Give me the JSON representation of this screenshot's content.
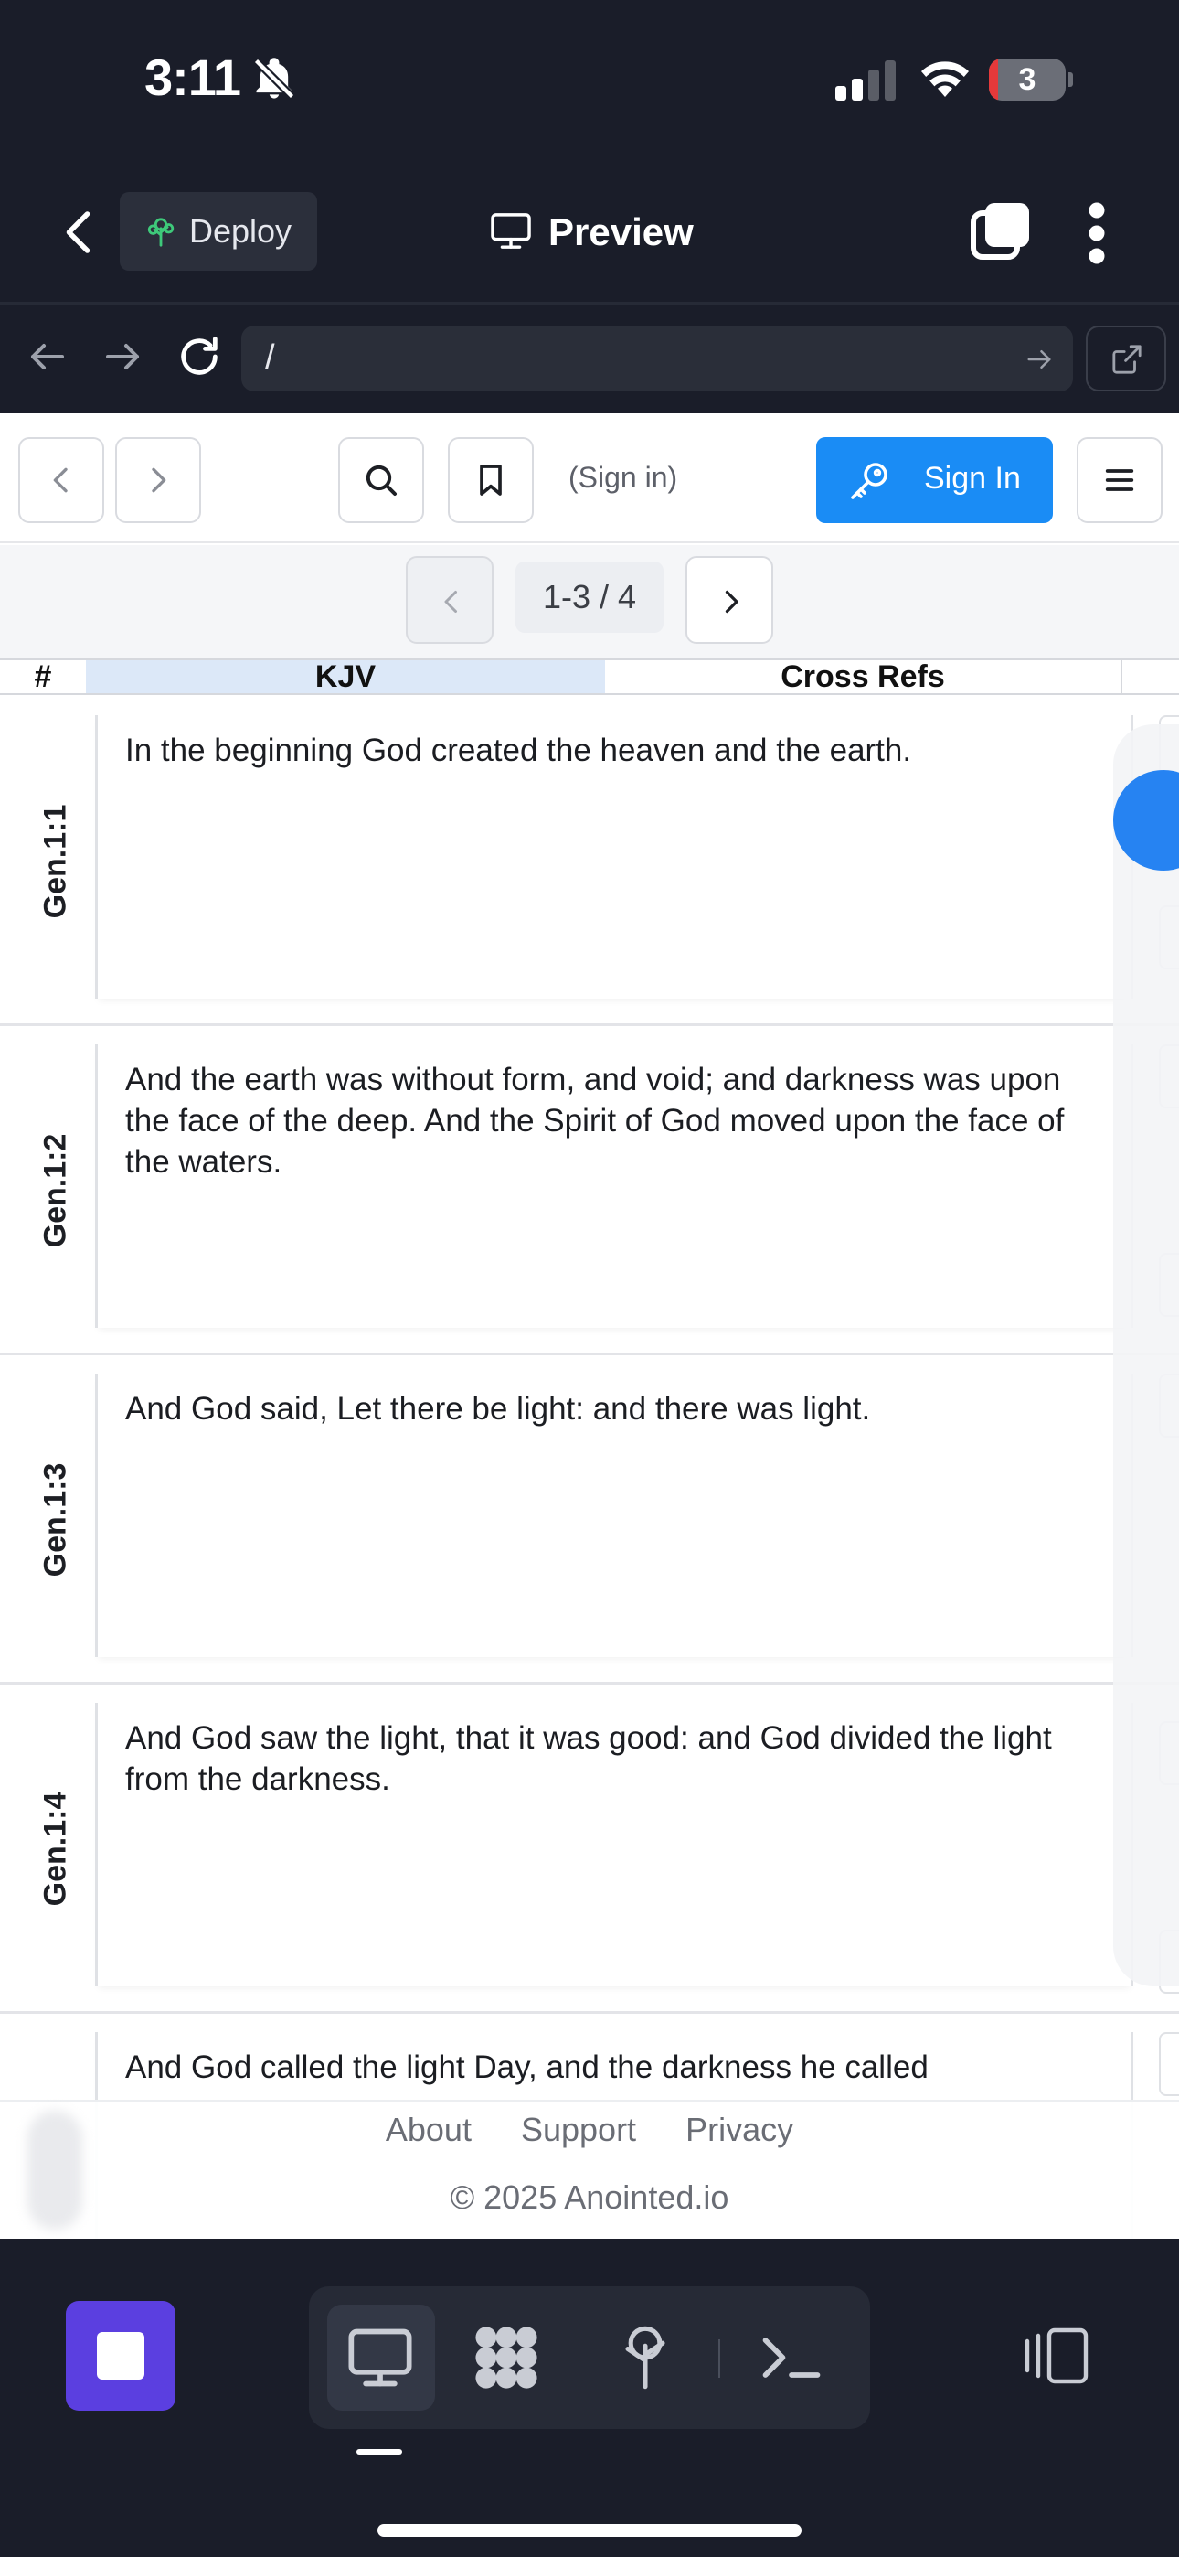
{
  "status_bar": {
    "time": "3:11",
    "battery_level": "3"
  },
  "toolbar": {
    "deploy_label": "Deploy",
    "preview_label": "Preview"
  },
  "url_bar": {
    "url": "/"
  },
  "site": {
    "sign_in_hint": "(Sign in)",
    "sign_in_label": "Sign In"
  },
  "pager": {
    "count": "1-3 / 4"
  },
  "columns": {
    "hash": "#",
    "kjv": "KJV",
    "cross_refs": "Cross Refs"
  },
  "verses": [
    {
      "ref": "Gen.1:1",
      "text": "In the beginning God created the heaven and the earth."
    },
    {
      "ref": "Gen.1:2",
      "text": "And the earth was without form, and void; and darkness was upon the face of the deep. And the Spirit of God moved upon the face of the waters."
    },
    {
      "ref": "Gen.1:3",
      "text": "And God said, Let there be light: and there was light."
    },
    {
      "ref": "Gen.1:4",
      "text": "And God saw the light, that it was good: and God divided the light from the darkness."
    },
    {
      "ref": "",
      "text": "And God called the light Day, and the darkness he called"
    }
  ],
  "footer": {
    "links": [
      "About",
      "Support",
      "Privacy"
    ],
    "copyright": "© 2025 Anointed.io"
  },
  "colors": {
    "accent": "#1a8cf5",
    "stop": "#5b3fe0",
    "chrome": "#1a1d29"
  }
}
